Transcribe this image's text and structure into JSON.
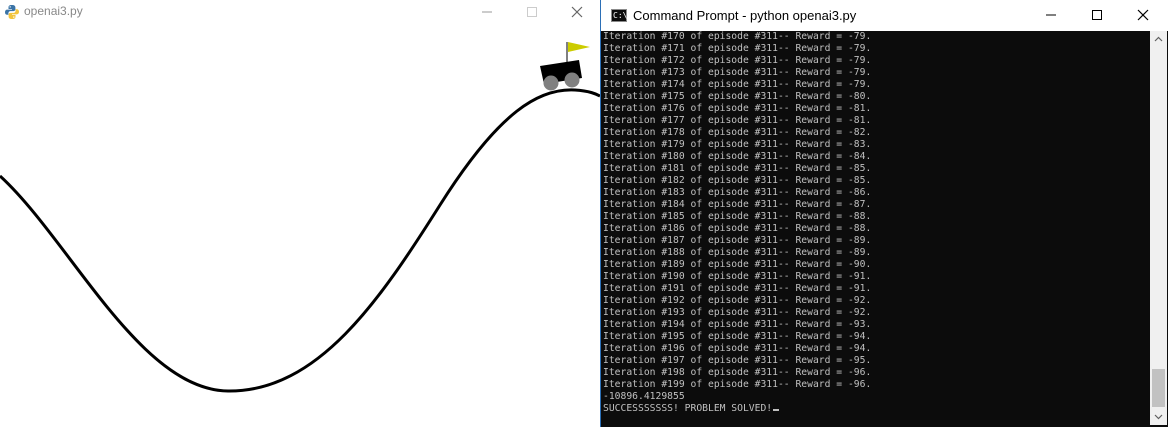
{
  "left_window": {
    "title": "openai3.py",
    "icon": "python-icon",
    "controls": [
      "minimize-icon",
      "maximize-icon",
      "close-icon"
    ],
    "flag_color": "#cccc00"
  },
  "cmd_window": {
    "title": "Command Prompt - python  openai3.py",
    "icon": "cmd-icon",
    "icon_text": "C:\\",
    "controls": [
      "minimize-icon",
      "maximize-icon",
      "close-icon"
    ],
    "lines": [
      "Iteration #170 of episode #311-- Reward = -79.",
      "Iteration #171 of episode #311-- Reward = -79.",
      "Iteration #172 of episode #311-- Reward = -79.",
      "Iteration #173 of episode #311-- Reward = -79.",
      "Iteration #174 of episode #311-- Reward = -79.",
      "Iteration #175 of episode #311-- Reward = -80.",
      "Iteration #176 of episode #311-- Reward = -81.",
      "Iteration #177 of episode #311-- Reward = -81.",
      "Iteration #178 of episode #311-- Reward = -82.",
      "Iteration #179 of episode #311-- Reward = -83.",
      "Iteration #180 of episode #311-- Reward = -84.",
      "Iteration #181 of episode #311-- Reward = -85.",
      "Iteration #182 of episode #311-- Reward = -85.",
      "Iteration #183 of episode #311-- Reward = -86.",
      "Iteration #184 of episode #311-- Reward = -87.",
      "Iteration #185 of episode #311-- Reward = -88.",
      "Iteration #186 of episode #311-- Reward = -88.",
      "Iteration #187 of episode #311-- Reward = -89.",
      "Iteration #188 of episode #311-- Reward = -89.",
      "Iteration #189 of episode #311-- Reward = -90.",
      "Iteration #190 of episode #311-- Reward = -91.",
      "Iteration #191 of episode #311-- Reward = -91.",
      "Iteration #192 of episode #311-- Reward = -92.",
      "Iteration #193 of episode #311-- Reward = -92.",
      "Iteration #194 of episode #311-- Reward = -93.",
      "Iteration #195 of episode #311-- Reward = -94.",
      "Iteration #196 of episode #311-- Reward = -94.",
      "Iteration #197 of episode #311-- Reward = -95.",
      "Iteration #198 of episode #311-- Reward = -96.",
      "Iteration #199 of episode #311-- Reward = -96.",
      "-10896.4129855"
    ],
    "final_line": "SUCCESSSSSSS! PROBLEM SOLVED!",
    "text_color": "#c0c0c0",
    "background_color": "#0c0c0c"
  }
}
